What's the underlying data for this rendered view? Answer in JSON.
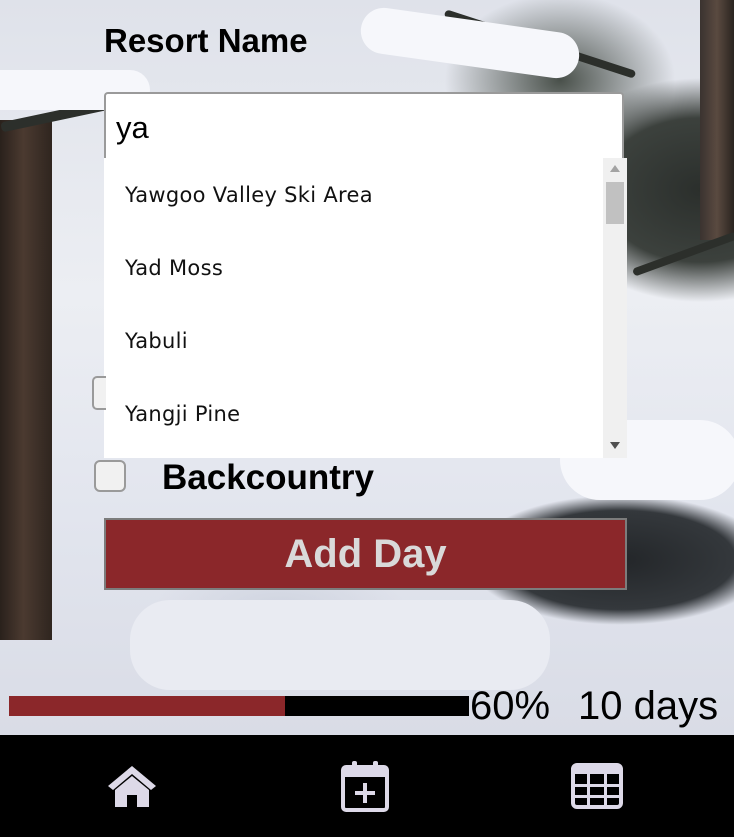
{
  "form": {
    "resort_label": "Resort Name",
    "resort_input_value": "ya",
    "suggestions": [
      "Yawgoo Valley Ski Area",
      "Yad Moss",
      "Yabuli",
      "Yangji Pine"
    ],
    "backcountry_label": "Backcountry",
    "backcountry_checked": false,
    "add_day_label": "Add Day"
  },
  "progress": {
    "fraction": 0.6,
    "percent_label": "60%",
    "days_label": "10 days"
  },
  "nav": {
    "items": [
      {
        "icon": "home-icon"
      },
      {
        "icon": "calendar-plus-icon"
      },
      {
        "icon": "grid-icon"
      }
    ]
  },
  "colors": {
    "accent": "#8b272a",
    "icon": "#ddd9e8",
    "nav_background": "#000000"
  }
}
